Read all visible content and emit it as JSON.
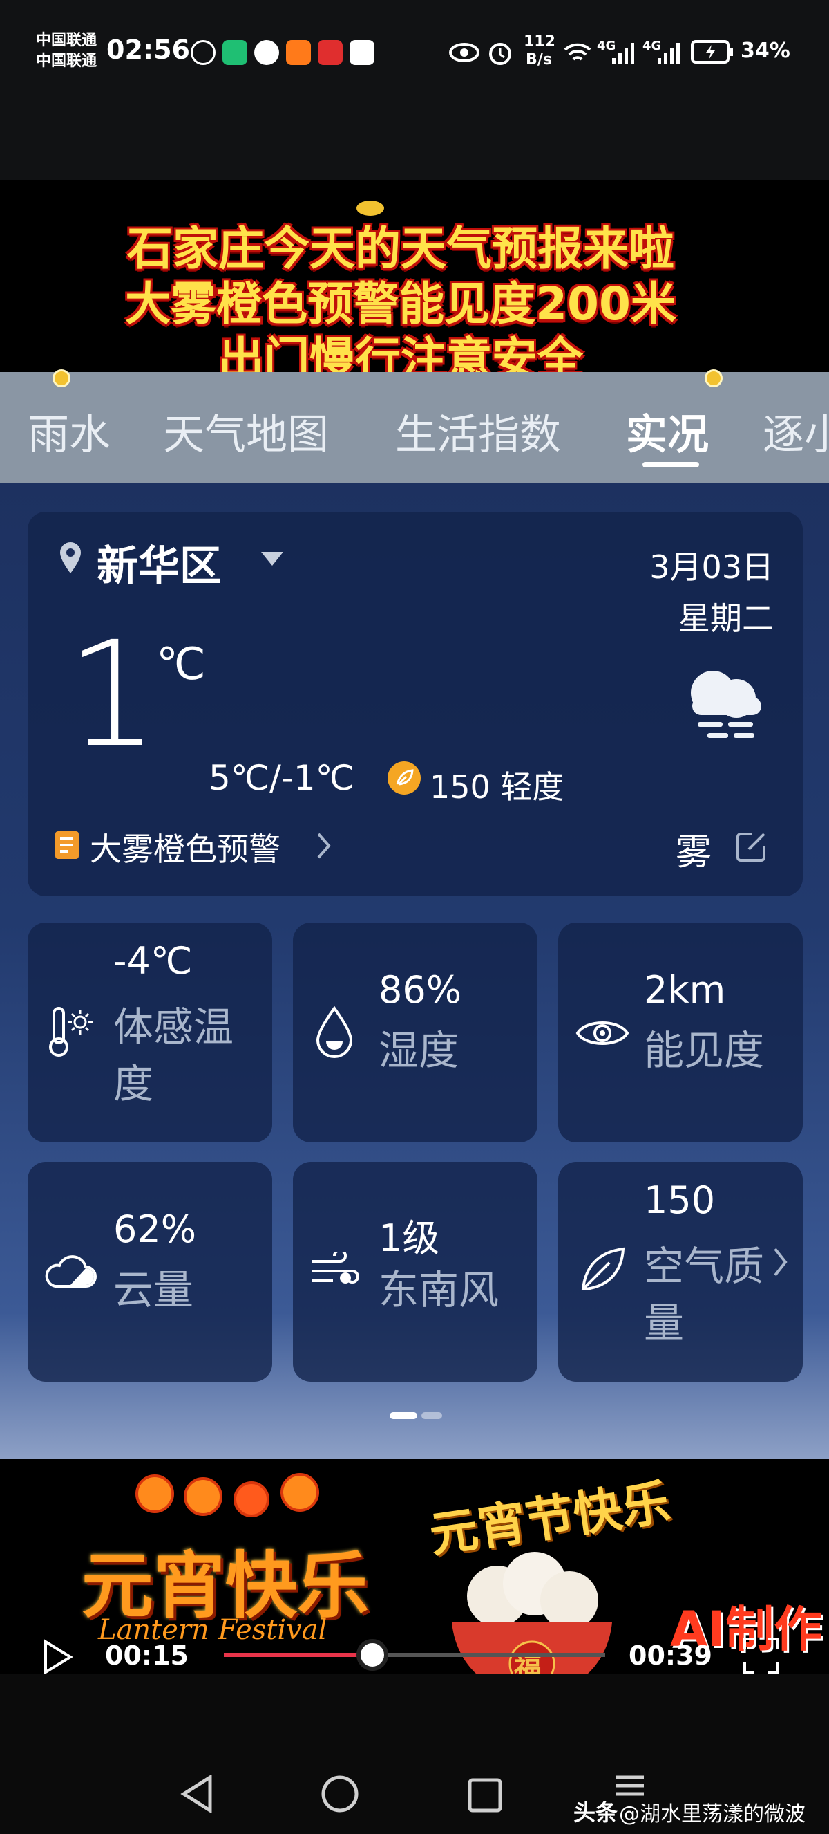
{
  "status_bar": {
    "carrier1": "中国联通",
    "carrier2": "中国联通",
    "time": "02:56",
    "net_speed_value": "112",
    "net_speed_unit": "B/s",
    "signal1": "4G",
    "signal2": "4G",
    "battery": "34%"
  },
  "overlay_top": {
    "line1": "石家庄今天的天气预报来啦",
    "line2": "大雾橙色预警能见度200米",
    "line3": "出门慢行注意安全"
  },
  "tabs": [
    {
      "label": "雨水"
    },
    {
      "label": "天气地图"
    },
    {
      "label": "生活指数"
    },
    {
      "label": "实况"
    },
    {
      "label": "逐小"
    }
  ],
  "current": {
    "location": "新华区",
    "date": "3月03日",
    "weekday": "星期二",
    "temp": "1",
    "temp_unit": "℃",
    "range": "5℃/-1℃",
    "aqi": "150 轻度",
    "warning": "大雾橙色预警",
    "condition": "雾"
  },
  "tiles": [
    {
      "value": "-4℃",
      "label": "体感温度",
      "icon": "thermometer-sun-icon"
    },
    {
      "value": "86%",
      "label": "湿度",
      "icon": "droplet-icon"
    },
    {
      "value": "2km",
      "label": "能见度",
      "icon": "eye-icon"
    },
    {
      "value": "62%",
      "label": "云量",
      "icon": "cloud-icon"
    },
    {
      "value": "1级",
      "label": "东南风",
      "icon": "wind-icon"
    },
    {
      "value": "150",
      "label": "空气质量",
      "icon": "leaf-icon"
    }
  ],
  "overlay_bottom": {
    "left_title": "元宵快乐",
    "left_sub": "Lantern Festival",
    "right_title": "元宵节快乐",
    "fu": "福",
    "ai_label": "AI制作"
  },
  "player": {
    "current_time": "00:15",
    "duration": "00:39",
    "progress": 0.39
  },
  "watermark": {
    "app": "头条",
    "author": "@湖水里荡漾的微波"
  },
  "colors": {
    "progress": "#e8344a",
    "accent_orange": "#f5a623",
    "overlay_text": "#ffe24a"
  }
}
